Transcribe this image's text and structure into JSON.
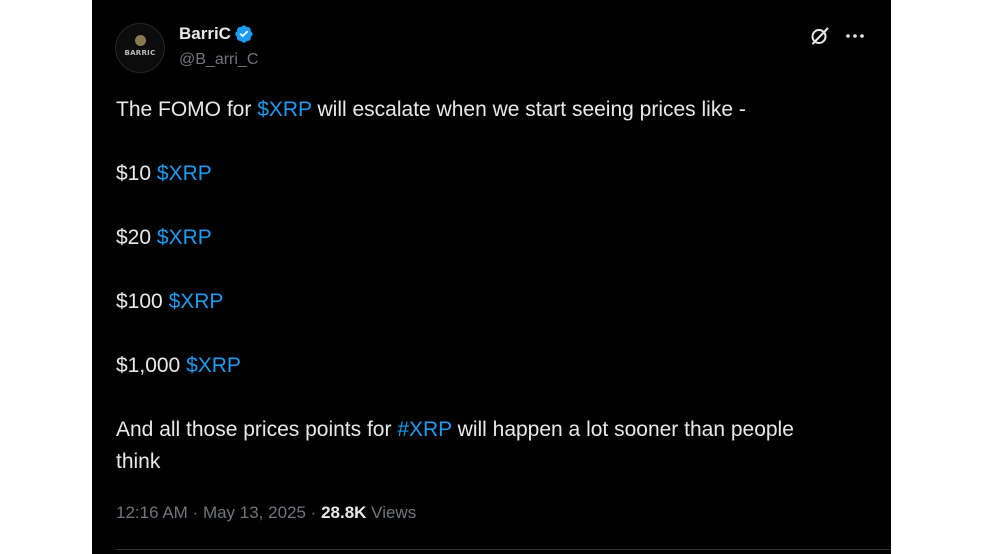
{
  "author": {
    "display_name": "BarriC",
    "handle": "@B_arri_C",
    "avatar_text": "BARRIC",
    "verified": true
  },
  "tweet": {
    "line1_pre": "The FOMO for ",
    "line1_link": "$XRP",
    "line1_post": " will escalate when we start seeing prices like -",
    "prices": [
      {
        "amount": "$10",
        "ticker": "$XRP"
      },
      {
        "amount": "$20",
        "ticker": "$XRP"
      },
      {
        "amount": "$100",
        "ticker": "$XRP"
      },
      {
        "amount": "$1,000",
        "ticker": "$XRP"
      }
    ],
    "closing_pre": "And all those prices points for ",
    "closing_link": "#XRP",
    "closing_post": " will happen a lot sooner than people think"
  },
  "meta": {
    "time": "12:16 AM",
    "separator": " · ",
    "date": "May 13, 2025",
    "views_count": "28.8K",
    "views_label": " Views"
  },
  "colors": {
    "background": "#000000",
    "text": "#e7e9ea",
    "link": "#1d9bf0",
    "muted": "#71767b",
    "verified": "#1d9bf0"
  },
  "icons": [
    "verified-badge-icon",
    "grok-icon",
    "more-options-icon"
  ]
}
